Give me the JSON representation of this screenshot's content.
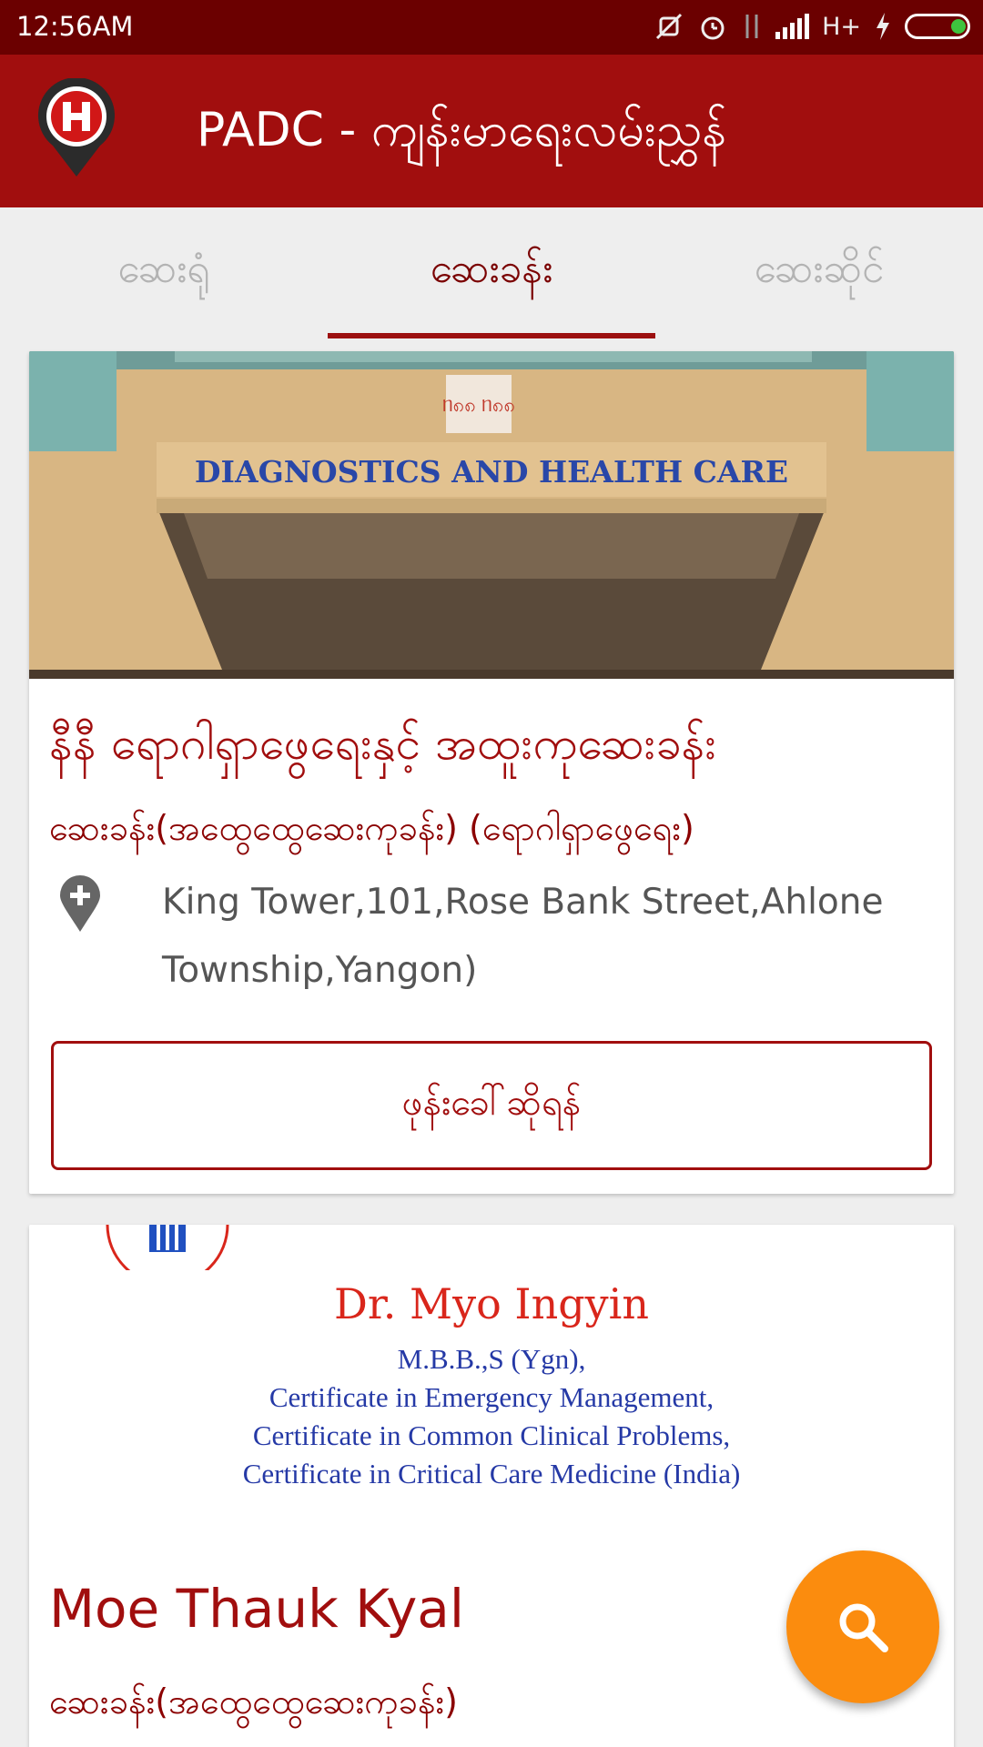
{
  "status_bar": {
    "time": "12:56AM",
    "network": "H+",
    "icons": [
      "mute-icon",
      "alarm-icon",
      "data-arrows-icon",
      "signal-icon",
      "charging-icon",
      "battery-icon"
    ]
  },
  "app_bar": {
    "title": "PADC - ကျန်းမာရေးလမ်းညွှန်",
    "logo": "hospital-pin-logo"
  },
  "tabs": [
    {
      "label": "ဆေးရုံ",
      "active": false
    },
    {
      "label": "ဆေးခန်း",
      "active": true
    },
    {
      "label": "ဆေးဆိုင်",
      "active": false
    }
  ],
  "cards": [
    {
      "image_text": {
        "logo": "ᥒ၈၈ ᥒ၈၈",
        "sign": "DIAGNOSTICS AND HEALTH CARE"
      },
      "title": "နီနီ ရောဂါရှာဖွေရေးနှင့် အထူးကုဆေးခန်း",
      "category": "ဆေးခန်း(အထွေထွေဆေးကုခန်း) (ရောဂါရှာဖွေရေး)",
      "address": "King Tower,101,Rose Bank Street,Ahlone Township,Yangon)",
      "call_label": "ဖုန်းခေါ်ဆိုရန်"
    },
    {
      "image_text": {
        "name": "Dr. Myo Ingyin",
        "lines": [
          "M.B.B.,S (Ygn),",
          "Certificate in Emergency Management,",
          "Certificate in Common Clinical Problems,",
          "Certificate in Critical Care Medicine (India)"
        ]
      },
      "title": "Moe Thauk Kyal",
      "category": "ဆေးခန်း(အထွေထွေဆေးကုခန်း)"
    }
  ],
  "fab": {
    "icon": "search-icon"
  },
  "colors": {
    "status_bar": "#6b0000",
    "app_bar": "#a10e0e",
    "accent": "#a10e0e",
    "fab": "#fb8c0e"
  }
}
